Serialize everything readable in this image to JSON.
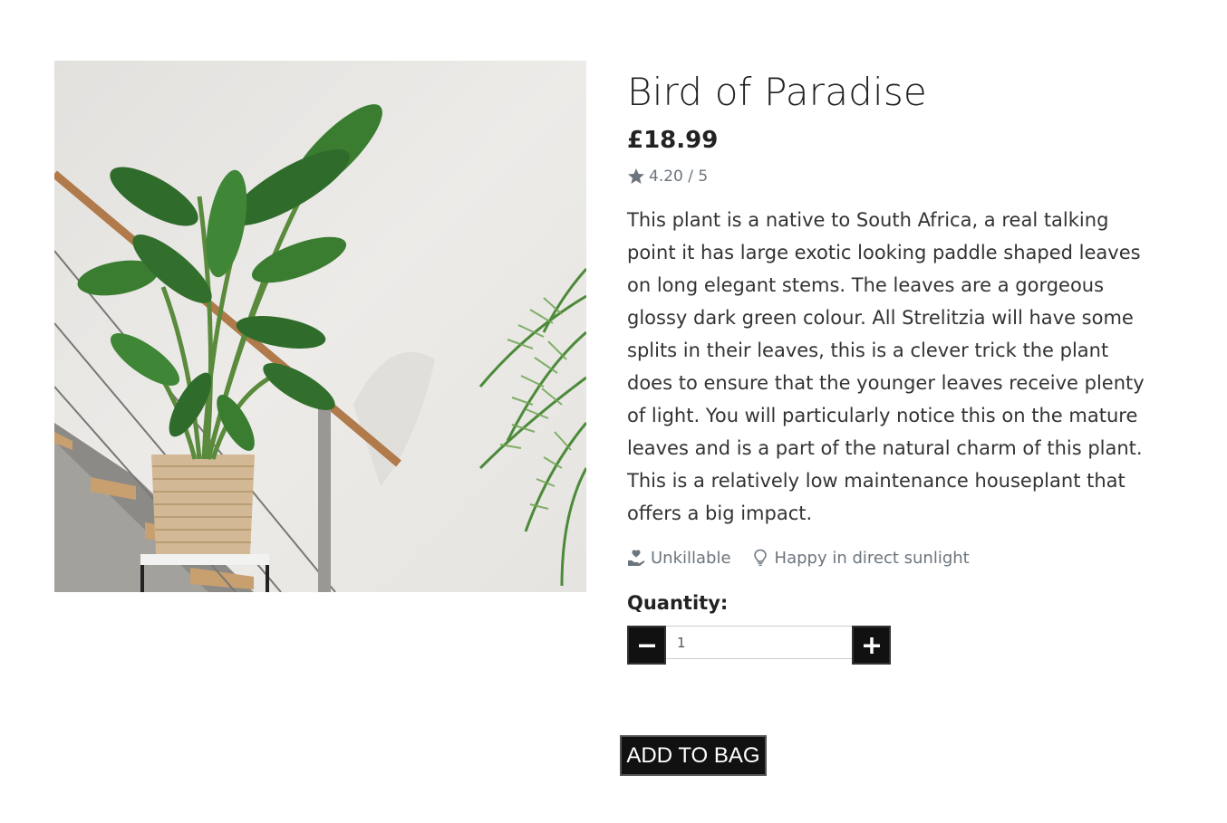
{
  "product": {
    "title": "Bird of Paradise",
    "price": "£18.99",
    "rating_text": "4.20 / 5",
    "description": "This plant is a native to South Africa, a real talking point it has large exotic looking paddle shaped leaves on long elegant stems. The leaves are a gorgeous glossy dark green colour. All Strelitzia will have some splits in their leaves, this is a clever trick the plant does to ensure that the younger leaves receive plenty of light. You will particularly notice this on the mature leaves and is a part of the natural charm of this plant. This is a relatively low maintenance houseplant that offers a big impact.",
    "features": [
      {
        "icon": "hand-holding-heart-icon",
        "label": "Unkillable"
      },
      {
        "icon": "lightbulb-icon",
        "label": "Happy in direct sunlight"
      }
    ]
  },
  "quantity": {
    "label": "Quantity:",
    "value": "1",
    "decrement_icon": "minus-icon",
    "increment_icon": "plus-icon"
  },
  "cart": {
    "add_label": "ADD TO BAG"
  },
  "colors": {
    "button_bg": "#111111",
    "muted_text": "#6c757d",
    "star": "#6c757d"
  }
}
